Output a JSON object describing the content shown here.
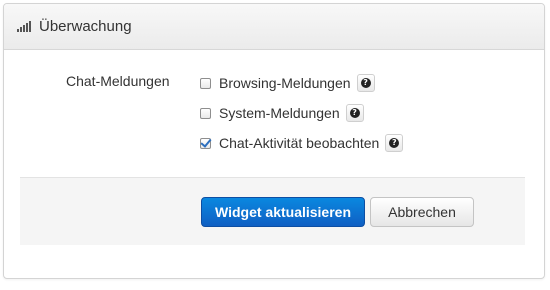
{
  "panel": {
    "title": "Überwachung",
    "icon": "signal-bars-icon"
  },
  "form": {
    "label": "Chat-Meldungen",
    "options": [
      {
        "label": "Browsing-Meldungen",
        "checked": false
      },
      {
        "label": "System-Meldungen",
        "checked": false
      },
      {
        "label": "Chat-Aktivität beobachten",
        "checked": true
      }
    ],
    "help_glyph": "?"
  },
  "actions": {
    "primary_label": "Widget aktualisieren",
    "cancel_label": "Abbrechen"
  },
  "colors": {
    "primary": "#0f6fd0",
    "checkmark": "#2d6fbe"
  }
}
